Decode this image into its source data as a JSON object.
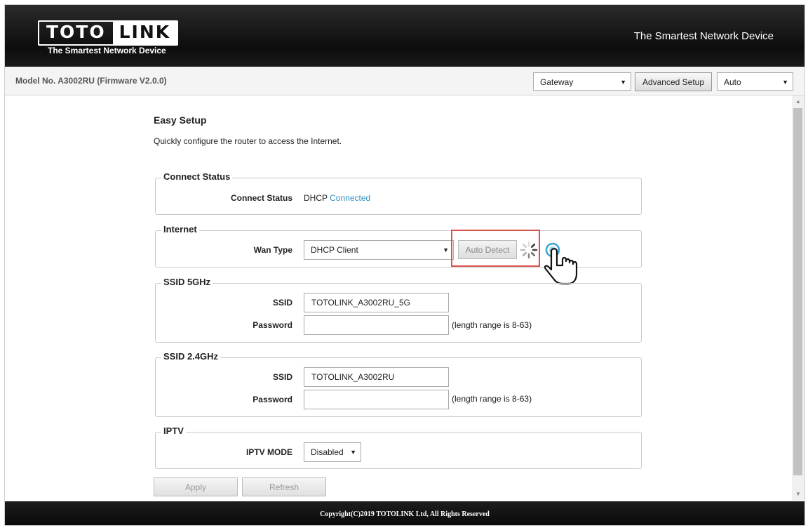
{
  "header": {
    "logo_left": "TOTO",
    "logo_right": "LINK",
    "logo_tagline": "The Smartest Network Device",
    "right_text": "The Smartest Network Device"
  },
  "toolbar": {
    "model": "Model No. A3002RU (Firmware V2.0.0)",
    "mode_select": "Gateway",
    "advanced_button": "Advanced Setup",
    "lang_select": "Auto"
  },
  "page": {
    "title": "Easy Setup",
    "subtitle": "Quickly configure the router to access the Internet."
  },
  "connect_status": {
    "legend": "Connect Status",
    "label": "Connect Status",
    "value_type": "DHCP",
    "value_state": "Connected",
    "state_color": "#2a8fbd"
  },
  "internet": {
    "legend": "Internet",
    "wan_label": "Wan Type",
    "wan_value": "DHCP Client",
    "auto_detect": "Auto Detect"
  },
  "ssid5": {
    "legend": "SSID 5GHz",
    "ssid_label": "SSID",
    "ssid_value": "TOTOLINK_A3002RU_5G",
    "password_label": "Password",
    "password_value": "",
    "hint": "(length range is 8-63)"
  },
  "ssid24": {
    "legend": "SSID 2.4GHz",
    "ssid_label": "SSID",
    "ssid_value": "TOTOLINK_A3002RU",
    "password_label": "Password",
    "password_value": "",
    "hint": "(length range is 8-63)"
  },
  "iptv": {
    "legend": "IPTV",
    "mode_label": "IPTV MODE",
    "mode_value": "Disabled"
  },
  "actions": {
    "apply": "Apply",
    "refresh": "Refresh"
  },
  "footer": {
    "copyright": "Copyright(C)2019 TOTOLINK Ltd, All Rights Reserved"
  },
  "icons": {
    "spinner": "loading-spinner-icon",
    "pointer": "hand-pointer-icon",
    "dropdown": "chevron-down-icon"
  }
}
